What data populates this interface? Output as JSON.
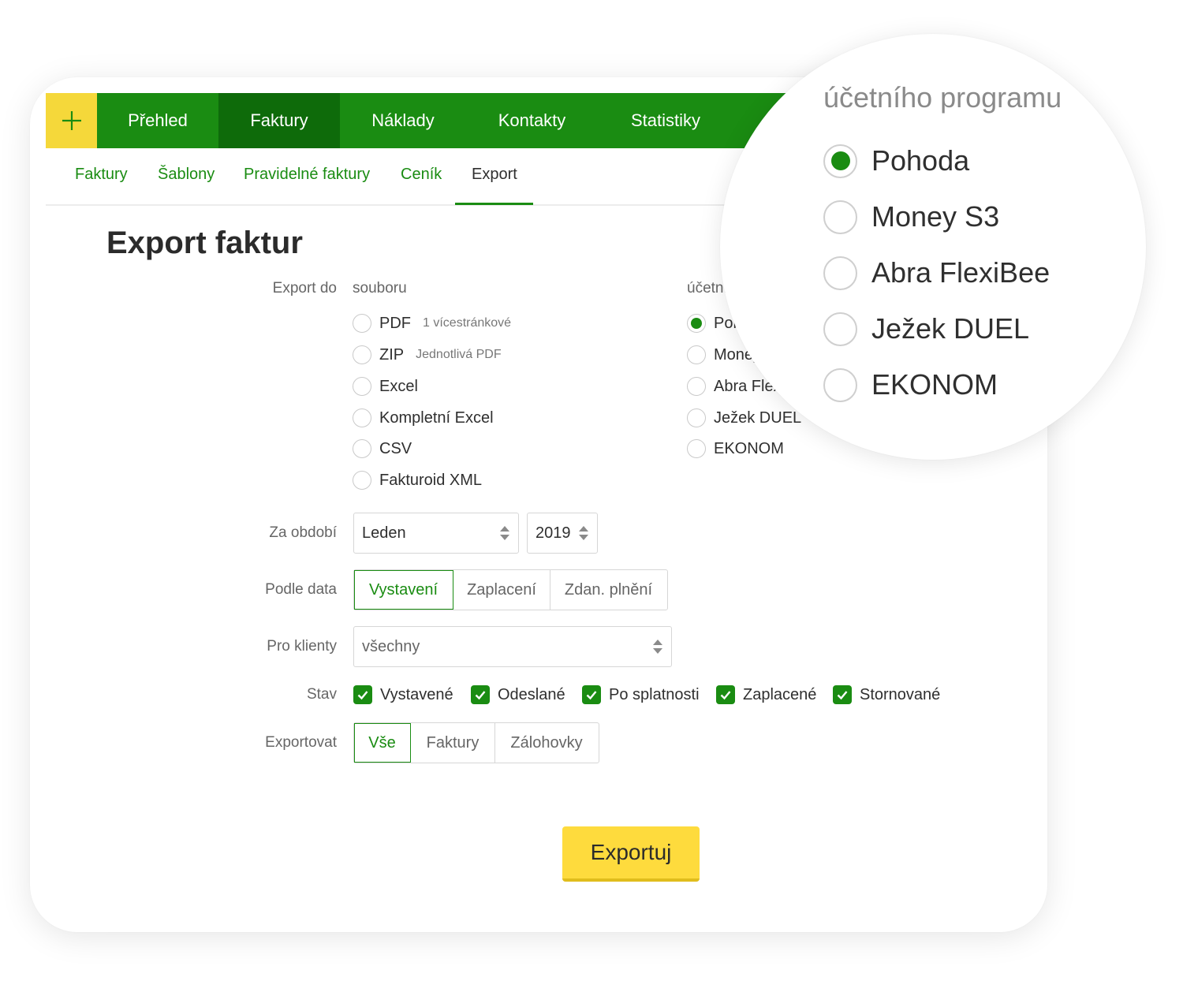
{
  "colors": {
    "brand_green": "#1a8c12",
    "active_green": "#0e6b0a",
    "accent_yellow": "#fedb3d"
  },
  "topnav": {
    "add_icon": "plus-icon",
    "items": [
      {
        "label": "Přehled",
        "active": false
      },
      {
        "label": "Faktury",
        "active": true
      },
      {
        "label": "Náklady",
        "active": false
      },
      {
        "label": "Kontakty",
        "active": false
      },
      {
        "label": "Statistiky",
        "active": false
      }
    ]
  },
  "subnav": {
    "items": [
      {
        "label": "Faktury",
        "active": false
      },
      {
        "label": "Šablony",
        "active": false
      },
      {
        "label": "Pravidelné faktury",
        "active": false
      },
      {
        "label": "Ceník",
        "active": false
      },
      {
        "label": "Export",
        "active": true
      }
    ]
  },
  "page_title": "Export faktur",
  "export_to": {
    "label": "Export do",
    "file_heading": "souboru",
    "file_options": [
      {
        "label": "PDF",
        "hint": "1 vícestránkové",
        "checked": false
      },
      {
        "label": "ZIP",
        "hint": "Jednotlivá PDF",
        "checked": false
      },
      {
        "label": "Excel",
        "hint": "",
        "checked": false
      },
      {
        "label": "Kompletní Excel",
        "hint": "",
        "checked": false
      },
      {
        "label": "CSV",
        "hint": "",
        "checked": false
      },
      {
        "label": "Fakturoid XML",
        "hint": "",
        "checked": false
      }
    ],
    "program_heading": "účetního programu",
    "program_options": [
      {
        "label": "Pohoda",
        "checked": true
      },
      {
        "label": "Money S3",
        "checked": false
      },
      {
        "label": "Abra FlexiBee",
        "checked": false
      },
      {
        "label": "Ježek DUEL",
        "checked": false
      },
      {
        "label": "EKONOM",
        "checked": false
      }
    ]
  },
  "period": {
    "label": "Za období",
    "month": "Leden",
    "year": "2019"
  },
  "by_date": {
    "label": "Podle data",
    "options": [
      "Vystavení",
      "Zaplacení",
      "Zdan. plnění"
    ],
    "selected": "Vystavení"
  },
  "clients": {
    "label": "Pro klienty",
    "value": "všechny"
  },
  "status": {
    "label": "Stav",
    "options": [
      {
        "label": "Vystavené",
        "checked": true
      },
      {
        "label": "Odeslané",
        "checked": true
      },
      {
        "label": "Po splatnosti",
        "checked": true
      },
      {
        "label": "Zaplacené",
        "checked": true
      },
      {
        "label": "Stornované",
        "checked": true
      }
    ]
  },
  "export_type": {
    "label": "Exportovat",
    "options": [
      "Vše",
      "Faktury",
      "Zálohovky"
    ],
    "selected": "Vše"
  },
  "submit_label": "Exportuj"
}
